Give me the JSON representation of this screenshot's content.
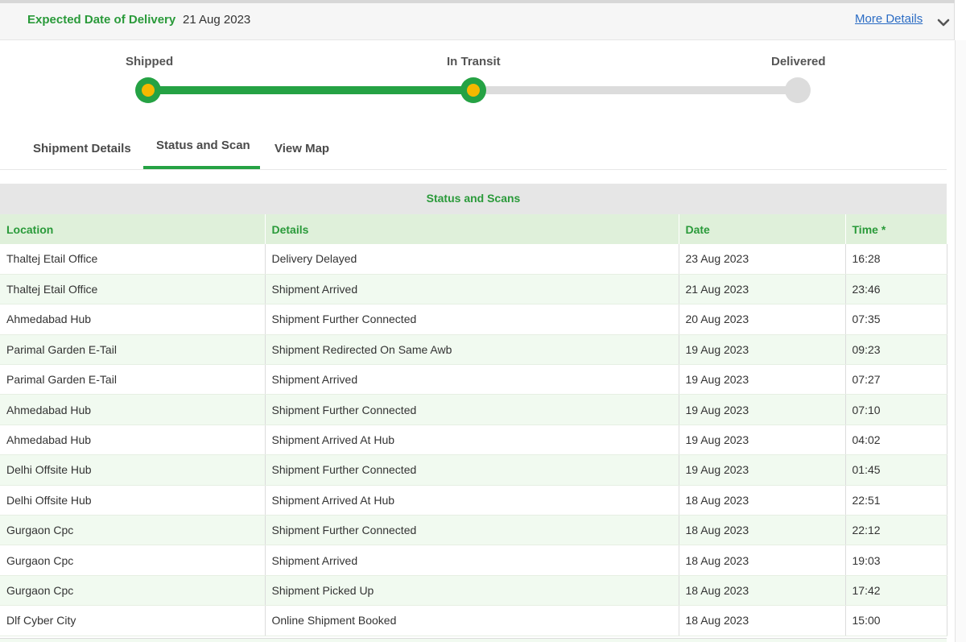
{
  "header": {
    "expected_label": "Expected Date of Delivery",
    "expected_date": "21 Aug 2023",
    "more_details": "More Details"
  },
  "progress": {
    "steps": [
      {
        "label": "Shipped",
        "state": "done"
      },
      {
        "label": "In Transit",
        "state": "done"
      },
      {
        "label": "Delivered",
        "state": "pending"
      }
    ],
    "completed_fraction": 0.5,
    "colors": {
      "done": "#25a244",
      "dot": "#f5b800",
      "pending": "#dcdcdc"
    }
  },
  "tabs": [
    {
      "label": "Shipment Details",
      "active": false
    },
    {
      "label": "Status and Scan",
      "active": true
    },
    {
      "label": "View Map",
      "active": false
    }
  ],
  "scans": {
    "caption": "Status and Scans",
    "columns": [
      "Location",
      "Details",
      "Date",
      "Time *"
    ],
    "rows": [
      [
        "Thaltej Etail Office",
        "Delivery Delayed",
        "23 Aug 2023",
        "16:28"
      ],
      [
        "Thaltej Etail Office",
        "Shipment Arrived",
        "21 Aug 2023",
        "23:46"
      ],
      [
        "Ahmedabad Hub",
        "Shipment Further Connected",
        "20 Aug 2023",
        "07:35"
      ],
      [
        "Parimal Garden E-Tail",
        "Shipment Redirected On Same Awb",
        "19 Aug 2023",
        "09:23"
      ],
      [
        "Parimal Garden E-Tail",
        "Shipment Arrived",
        "19 Aug 2023",
        "07:27"
      ],
      [
        "Ahmedabad Hub",
        "Shipment Further Connected",
        "19 Aug 2023",
        "07:10"
      ],
      [
        "Ahmedabad Hub",
        "Shipment Arrived At Hub",
        "19 Aug 2023",
        "04:02"
      ],
      [
        "Delhi Offsite Hub",
        "Shipment Further Connected",
        "19 Aug 2023",
        "01:45"
      ],
      [
        "Delhi Offsite Hub",
        "Shipment Arrived At Hub",
        "18 Aug 2023",
        "22:51"
      ],
      [
        "Gurgaon Cpc",
        "Shipment Further Connected",
        "18 Aug 2023",
        "22:12"
      ],
      [
        "Gurgaon Cpc",
        "Shipment Arrived",
        "18 Aug 2023",
        "19:03"
      ],
      [
        "Gurgaon Cpc",
        "Shipment Picked Up",
        "18 Aug 2023",
        "17:42"
      ],
      [
        "Dlf Cyber City",
        "Online Shipment Booked",
        "18 Aug 2023",
        "15:00"
      ]
    ]
  }
}
